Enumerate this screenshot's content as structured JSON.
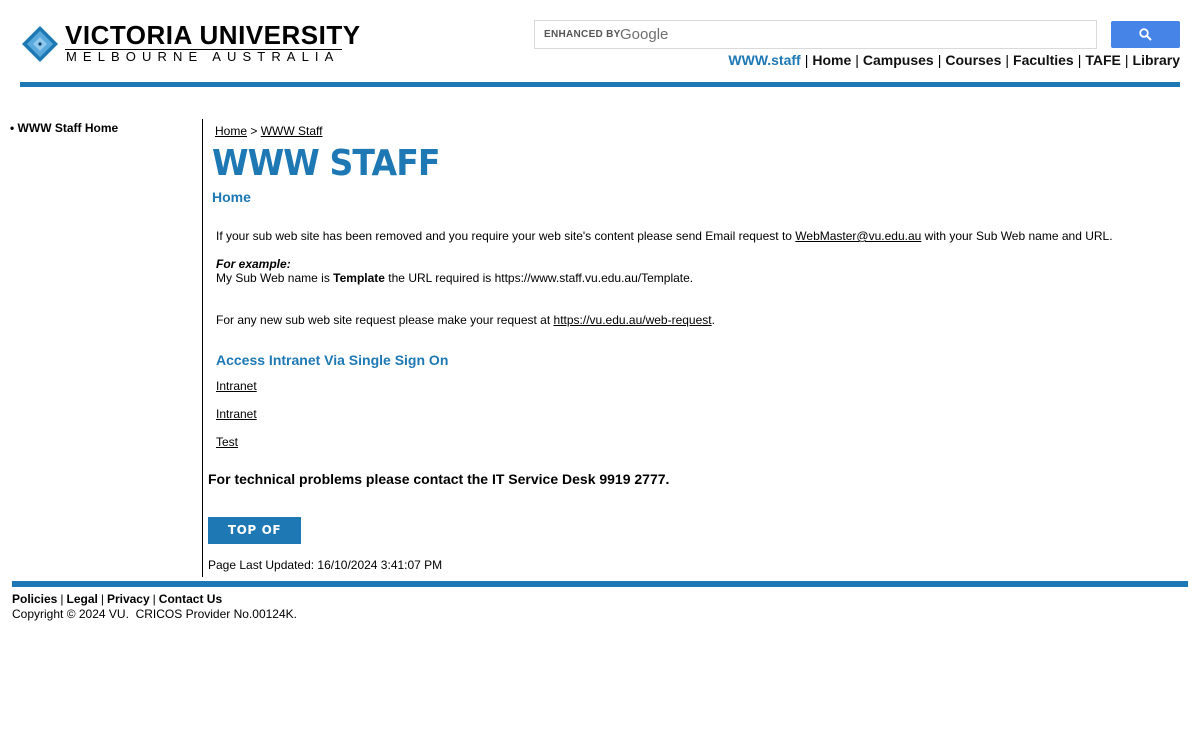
{
  "header": {
    "logo_name": "VICTORIA UNIVERSITY",
    "logo_sub": "MELBOURNE AUSTRALIA",
    "search": {
      "enhanced_label": "ENHANCED BY",
      "google": "Google"
    },
    "nav": [
      "WWW.staff",
      "Home",
      "Campuses",
      "Courses",
      "Faculties",
      "TAFE",
      "Library"
    ],
    "nav_separator": "|"
  },
  "sidebar": {
    "item": "• WWW Staff Home"
  },
  "breadcrumb": {
    "home": "Home",
    "separator": ">",
    "current": "WWW Staff"
  },
  "main": {
    "section_title": "WWW STAFF",
    "page_heading": "Home",
    "p1_before": "If your sub web site has been removed and you require your web site's content please send Email request to ",
    "p1_email": "WebMaster@vu.edu.au",
    "p1_after": " with your Sub Web name and URL.",
    "example_label": "For example:",
    "p2_before": "My Sub Web name is ",
    "p2_bold": "Template",
    "p2_after": " the URL required is https://www.staff.vu.edu.au/Template.",
    "p3_before": "For any new sub web site request please make your request at ",
    "p3_link": "https://vu.edu.au/web-request",
    "p3_after": ".",
    "sso_heading": "Access Intranet Via Single Sign On",
    "links": [
      "Intranet",
      "Intranet",
      "Test"
    ],
    "tech": "For technical problems please contact the IT Service Desk 9919 2777.",
    "top_button": "TOP OF PAGE",
    "updated": "Page Last Updated: 16/10/2024 3:41:07 PM"
  },
  "footer": {
    "links": [
      "Policies",
      "Legal",
      "Privacy",
      "Contact Us"
    ],
    "copyright": "Copyright © 2024 VU.  CRICOS Provider No.00124K."
  },
  "colors": {
    "accent": "#1e78b4",
    "search_button": "#4784e8"
  }
}
